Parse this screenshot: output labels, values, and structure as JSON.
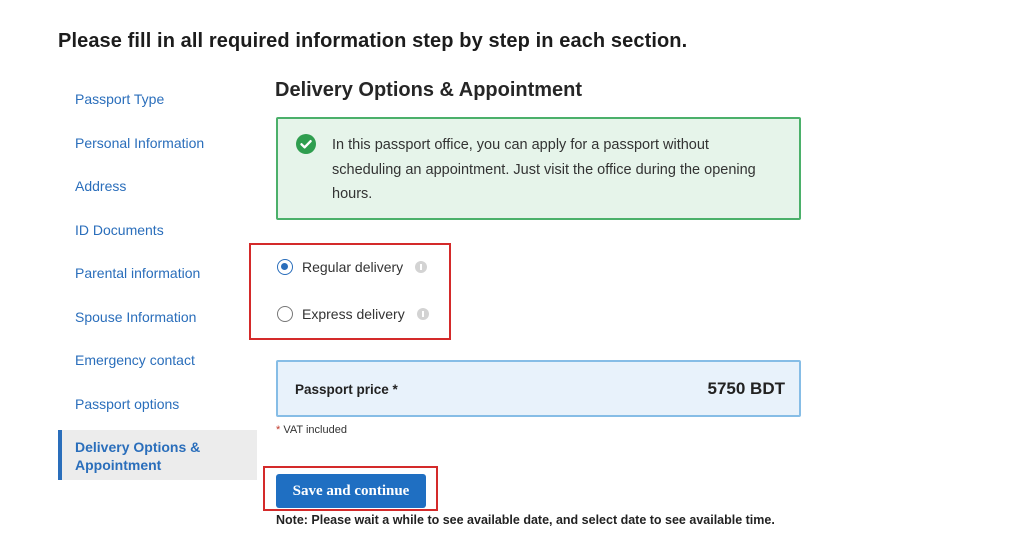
{
  "page": {
    "heading": "Please fill in all required information step by step in each section."
  },
  "sidebar": {
    "items": [
      {
        "label": "Passport Type"
      },
      {
        "label": "Personal Information"
      },
      {
        "label": "Address"
      },
      {
        "label": "ID Documents"
      },
      {
        "label": "Parental information"
      },
      {
        "label": "Spouse Information"
      },
      {
        "label": "Emergency contact"
      },
      {
        "label": "Passport options"
      },
      {
        "label": "Delivery Options & Appointment",
        "active": true
      }
    ]
  },
  "main": {
    "title": "Delivery Options & Appointment",
    "info": {
      "icon": "check-circle-icon",
      "color": "#2f9e4f",
      "text": "In this passport office, you can apply for a passport without scheduling an appointment. Just visit the office during the opening hours."
    },
    "delivery": {
      "options": [
        {
          "label": "Regular delivery",
          "selected": true
        },
        {
          "label": "Express delivery",
          "selected": false
        }
      ]
    },
    "price": {
      "label": "Passport price *",
      "value": "5750 BDT"
    },
    "vat": {
      "star": "*",
      "text": " VAT included"
    },
    "save_label": "Save and continue",
    "note": "Note: Please wait a while to see available date, and select date to see available time."
  },
  "colors": {
    "accent": "#2a6ebb",
    "button": "#1f6fc2",
    "highlight_frame": "#d42a2a",
    "success_bg": "#e6f4ea",
    "price_bg": "#e8f2fb"
  }
}
